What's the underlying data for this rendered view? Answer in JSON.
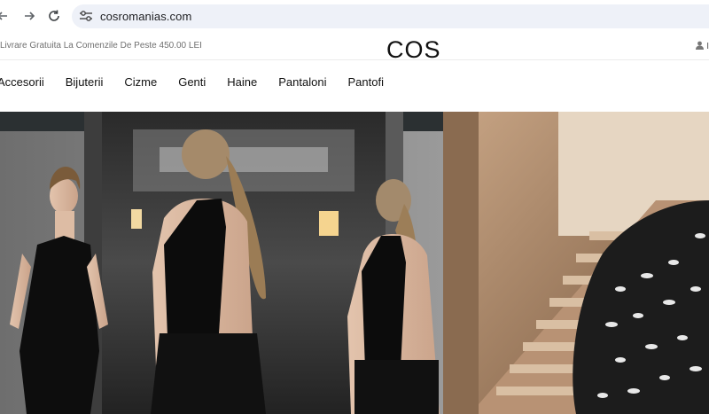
{
  "browser": {
    "back_icon": "arrow-left-icon",
    "forward_icon": "arrow-right-icon",
    "reload_icon": "reload-icon",
    "site_info_icon": "tune-icon",
    "url": "cosromanias.com"
  },
  "header": {
    "promo_text": "Livrare Gratuita La Comenzile De Peste 450.00 LEI",
    "logo_text": "COS",
    "account_text": "I"
  },
  "nav": {
    "items": [
      {
        "label": "Accesorii"
      },
      {
        "label": "Bijuterii"
      },
      {
        "label": "Cizme"
      },
      {
        "label": "Genti"
      },
      {
        "label": "Haine"
      },
      {
        "label": "Pantaloni"
      },
      {
        "label": "Pantofi"
      }
    ]
  },
  "hero": {
    "description": "Fashion campaign photo: models in black halter dresses in a mirrored hallway; wooden staircase and patterned jacket on the right"
  }
}
